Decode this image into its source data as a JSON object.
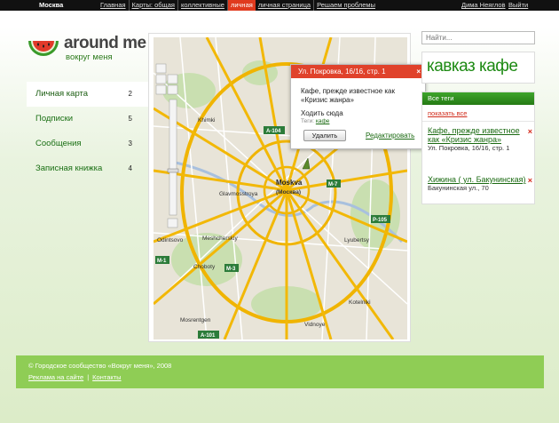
{
  "topbar": {
    "city": "Москва",
    "nav": [
      "Главная",
      "Карты: общая",
      "коллективные",
      "личная",
      "личная страница",
      "Решаем проблемы"
    ],
    "active_index": 3,
    "user": "Дима Неяглов",
    "logout": "Выйти"
  },
  "logo": {
    "name": "around me",
    "subtitle": "вокруг меня"
  },
  "menu": [
    {
      "label": "Личная карта",
      "count": "2"
    },
    {
      "label": "Подписки",
      "count": "5"
    },
    {
      "label": "Сообщения",
      "count": "3"
    },
    {
      "label": "Записная книжка",
      "count": "4"
    }
  ],
  "map": {
    "labels": {
      "khimki": "Khimki",
      "moskva": "Moskva",
      "moskva_ru": "(Москва)",
      "lyubertsy": "Lyubertsy",
      "odintsovo": "Odintsovo",
      "meshcherskiy": "Meshcherskiy",
      "chobotу": "Chobotу",
      "vidnoye": "Vidnoye",
      "kotelniki": "Kotelniki",
      "mosrentgen": "Mosrentgen",
      "glavmosstroya": "Glavmosstroya",
      "a104": "A-104",
      "a101": "A-101",
      "m1": "M-1",
      "m3": "M-3",
      "m7": "M-7",
      "p105": "P-105"
    }
  },
  "popup": {
    "header": "Ул. Покровка, 16/16, стр. 1",
    "close": "×",
    "title": "Кафе, прежде известное как «Кризис жанра»",
    "goto": "Ходить сюда",
    "tags_label": "Теги:",
    "tag": "кафе",
    "delete": "Удалить",
    "edit": "Редактировать"
  },
  "search": {
    "placeholder": "Найти..."
  },
  "place_title": "кавказ кафе",
  "tags_panel": {
    "header": "Все теги",
    "show_all": "показать все",
    "entries": [
      {
        "name": "Кафе, прежде известное как «Кризис жанра»",
        "address": "Ул. Покровка, 16/16, стр. 1"
      },
      {
        "name": "Хижина ( ул. Бакунинская)",
        "address": "Бакунинская ул., 70"
      }
    ],
    "remove": "×"
  },
  "footer": {
    "copyright": "© Городское сообщество «Вокруг меня», 2008",
    "links": [
      "Реклама на сайте",
      "Контакты"
    ]
  },
  "colors": {
    "accent_green": "#1d8a13",
    "active_nav": "#e03a1e",
    "footer_bg": "#8fcd55"
  }
}
